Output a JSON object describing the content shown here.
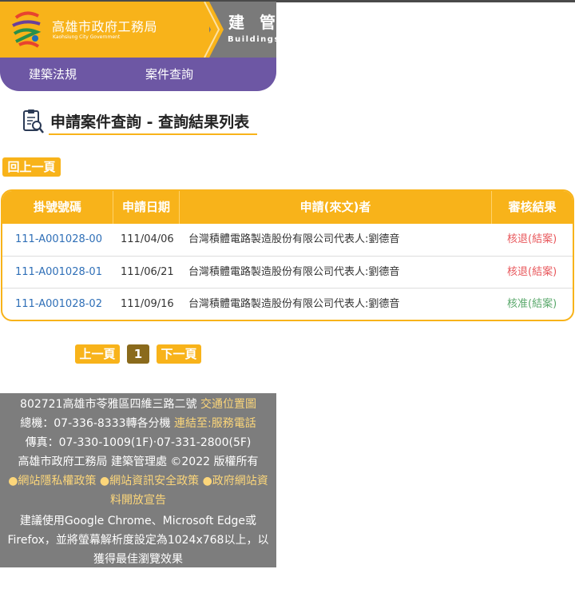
{
  "header": {
    "org_name_zh": "高雄市政府工務局",
    "org_name_en": "Kaohsiung City Government",
    "dept_zh": "建 管 處",
    "dept_en": "Buildings"
  },
  "nav": {
    "items": [
      {
        "label": "建築法規"
      },
      {
        "label": "案件查詢"
      }
    ]
  },
  "page": {
    "title": "申請案件查詢 - 查詢結果列表",
    "back_button": "回上一頁"
  },
  "table": {
    "headers": [
      "掛號號碼",
      "申請日期",
      "申請(來文)者",
      "審核結果"
    ],
    "rows": [
      {
        "no": "111-A001028-00",
        "date": "111/04/06",
        "applicant": "台灣積體電路製造股份有限公司代表人:劉德音",
        "result": "核退(結案)",
        "result_color": "#e8575b"
      },
      {
        "no": "111-A001028-01",
        "date": "111/06/21",
        "applicant": "台灣積體電路製造股份有限公司代表人:劉德音",
        "result": "核退(結案)",
        "result_color": "#e8575b"
      },
      {
        "no": "111-A001028-02",
        "date": "111/09/16",
        "applicant": "台灣積體電路製造股份有限公司代表人:劉德音",
        "result": "核准(結案)",
        "result_color": "#5aa86b"
      }
    ]
  },
  "pagination": {
    "prev": "上一頁",
    "current": "1",
    "next": "下一頁"
  },
  "footer": {
    "address": "802721高雄市苓雅區四維三路二號",
    "traffic_link": "交通位置圖",
    "phone": "總機：07-336-8333轉各分機",
    "service_link": "連結至:服務電話",
    "fax": "傳真：07-330-1009(1F)‧07-331-2800(5F)",
    "copyright": "高雄市政府工務局 建築管理處 ©2022 版權所有",
    "policy_links": [
      "●網站隱私權政策",
      "●網站資訊安全政策",
      "●政府網站資",
      "料開放宣告"
    ],
    "browser_note": [
      "建議使用Google Chrome、Microsoft Edge或",
      "Firefox，並將螢幕解析度設定為1024x768以上，以",
      "獲得最佳瀏覽效果"
    ]
  },
  "colors": {
    "accent_yellow": "#f8b31a",
    "nav_purple": "#6d57a4",
    "footer_gray": "#7d7d7d",
    "link_blue": "#2f6fb7",
    "reject_red": "#e8575b",
    "approve_green": "#5aa86b"
  }
}
